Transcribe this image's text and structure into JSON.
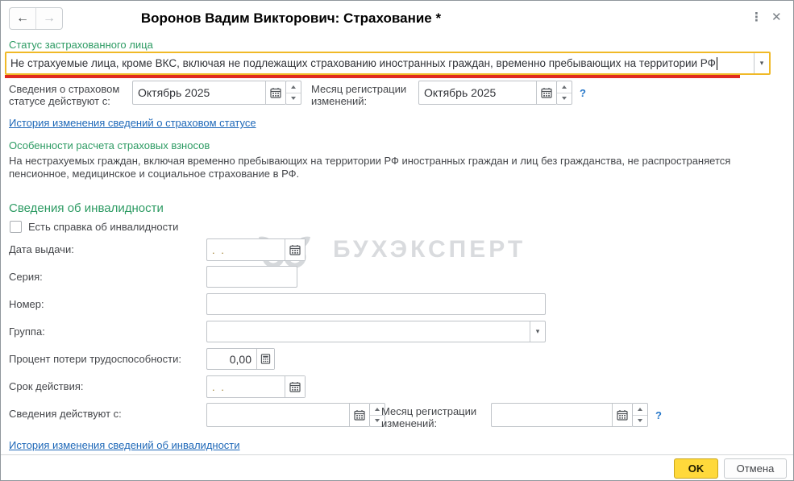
{
  "window": {
    "title": "Воронов Вадим Викторович: Страхование *",
    "more_icon": "⋮",
    "close_icon": "✕"
  },
  "nav": {
    "back": "←",
    "forward": "→"
  },
  "status": {
    "label": "Статус застрахованного лица",
    "value": "Не страхуемые лица, кроме ВКС, включая не подлежащих страхованию иностранных граждан, временно пребывающих на территории РФ",
    "dropdown_icon": "▾"
  },
  "insurance_row": {
    "period_label": "Сведения о страховом статусе действуют с:",
    "period_value": "Октябрь 2025",
    "month_label": "Месяц регистрации изменений:",
    "month_value": "Октябрь 2025",
    "help": "?"
  },
  "history_status_link": "История изменения сведений о страховом статусе",
  "notes": {
    "title": "Особенности расчета страховых взносов",
    "text": "На нестрахуемых граждан, включая временно пребывающих на территории РФ иностранных граждан и лиц без гражданства, не распространяется пенсионное, медицинское и социальное страхование в РФ."
  },
  "disability": {
    "header": "Сведения об инвалидности",
    "checkbox_label": "Есть справка об инвалидности",
    "issue_date_label": "Дата выдачи:",
    "date_placeholder": ".  .",
    "series_label": "Серия:",
    "number_label": "Номер:",
    "group_label": "Группа:",
    "group_dropdown_icon": "▾",
    "percent_label": "Процент потери трудоспособности:",
    "percent_value": "0,00",
    "validity_label": "Срок действия:",
    "effective_label": "Сведения действуют с:",
    "month_label": "Месяц регистрации изменений:",
    "help": "?"
  },
  "history_disability_link": "История изменения сведений об инвалидности",
  "footer": {
    "ok": "OK",
    "cancel": "Отмена"
  },
  "watermark": {
    "text": "БУХЭКСПЕРТ"
  },
  "colors": {
    "accent_green": "#2d9b63",
    "link_blue": "#1e68b8",
    "highlight_border": "#f0b927",
    "underline_red": "#e02b20",
    "ok_yellow": "#ffd93b"
  }
}
